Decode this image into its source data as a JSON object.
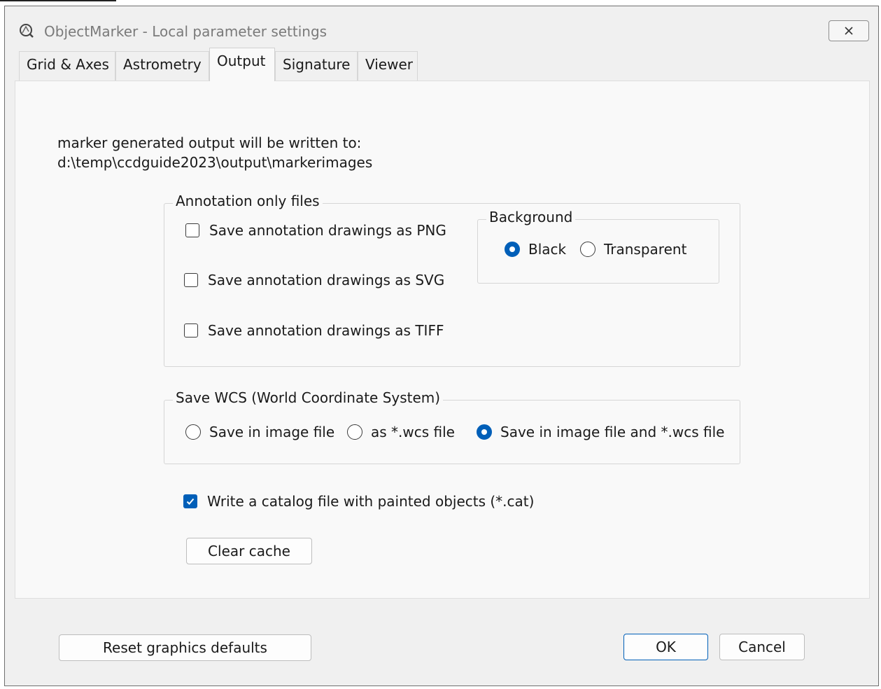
{
  "window": {
    "title": "ObjectMarker - Local parameter settings",
    "icon": "app-icon",
    "close_icon": "close-icon"
  },
  "tabs": [
    {
      "label": "Grid & Axes",
      "active": false
    },
    {
      "label": "Astrometry",
      "active": false
    },
    {
      "label": "Output",
      "active": true
    },
    {
      "label": "Signature",
      "active": false
    },
    {
      "label": "Viewer",
      "active": false
    }
  ],
  "output": {
    "label": "marker generated output will be written to:",
    "path": "d:\\temp\\ccdguide2023\\output\\markerimages"
  },
  "annotation": {
    "legend": "Annotation only files",
    "options": [
      {
        "label": "Save annotation drawings as PNG",
        "checked": false
      },
      {
        "label": "Save annotation drawings as SVG",
        "checked": false
      },
      {
        "label": "Save annotation drawings as TIFF",
        "checked": false
      }
    ],
    "background": {
      "legend": "Background",
      "options": [
        {
          "label": "Black",
          "selected": true
        },
        {
          "label": "Transparent",
          "selected": false
        }
      ]
    }
  },
  "wcs": {
    "legend": "Save WCS (World Coordinate System)",
    "options": [
      {
        "label": "Save in image file",
        "selected": false
      },
      {
        "label": "as *.wcs file",
        "selected": false
      },
      {
        "label": "Save in image file and *.wcs file",
        "selected": true
      }
    ]
  },
  "catalog": {
    "label": "Write a catalog file with painted objects (*.cat)",
    "checked": true
  },
  "buttons": {
    "clear_cache": "Clear cache",
    "reset": "Reset graphics defaults",
    "ok": "OK",
    "cancel": "Cancel"
  },
  "colors": {
    "accent": "#005fb8",
    "window_bg": "#f0f0f0",
    "panel_bg": "#f9f9f9"
  }
}
